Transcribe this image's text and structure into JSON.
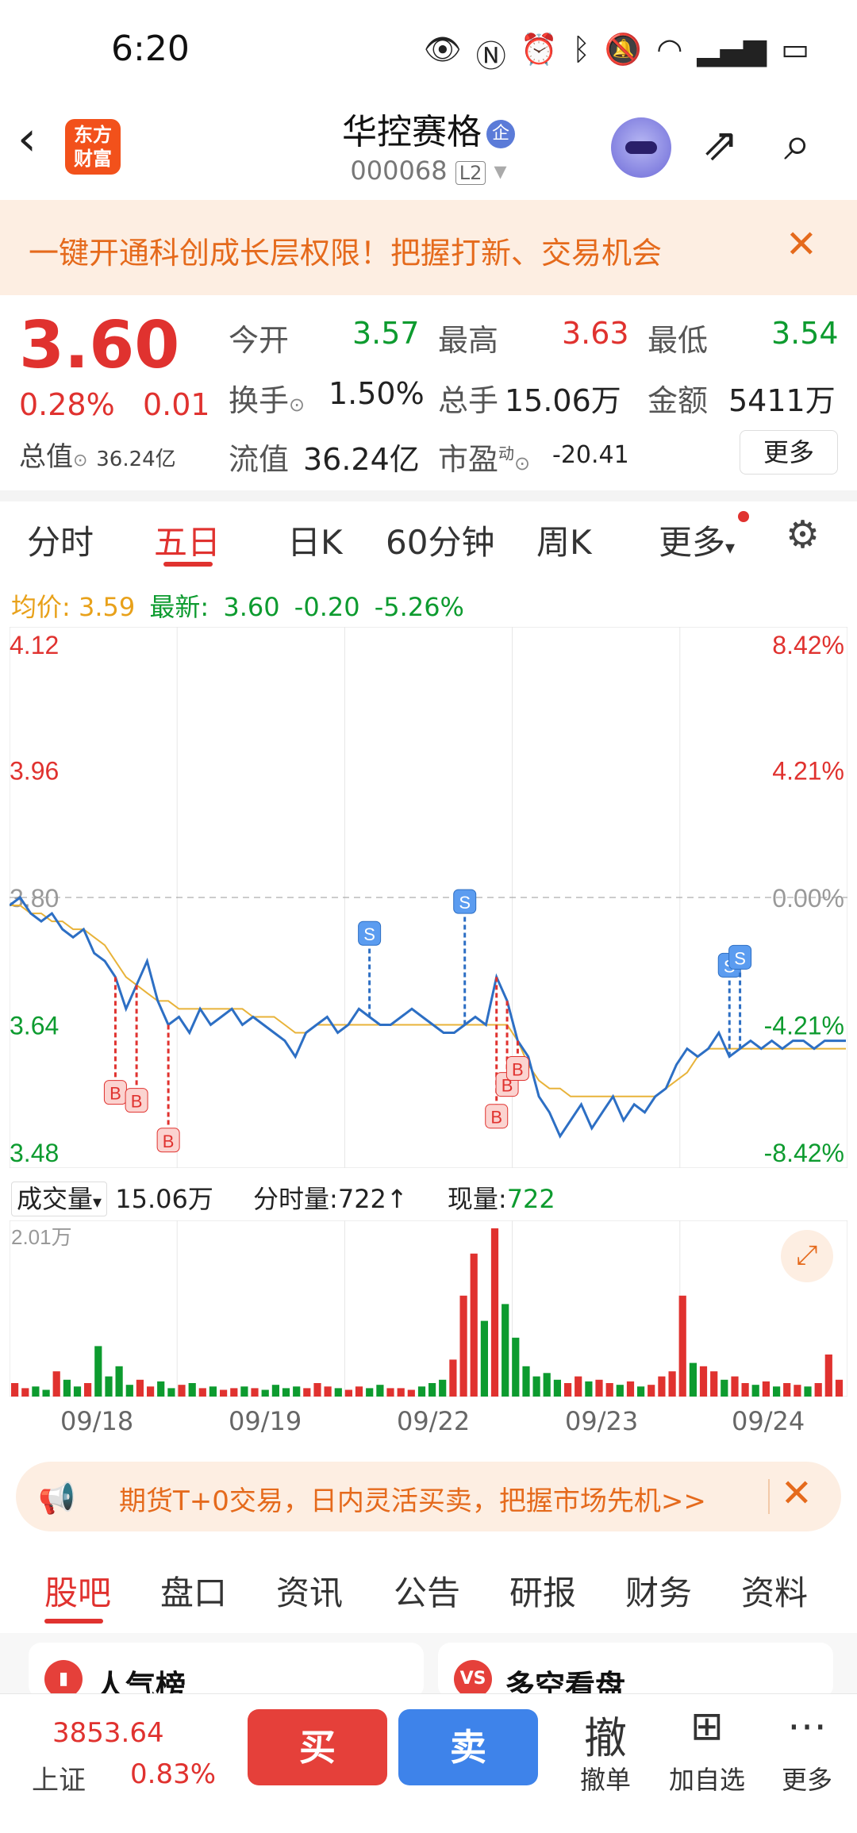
{
  "status": {
    "time": "6:20",
    "icons": [
      "eye-icon",
      "nfc-icon",
      "alarm-icon",
      "bluetooth-icon",
      "mute-icon",
      "wifi-icon",
      "4g-signal-icon",
      "battery-icon"
    ]
  },
  "header": {
    "logo_text": "东方\n财富",
    "stock_name": "华控赛格",
    "badge": "企",
    "stock_code": "000068",
    "level": "L2"
  },
  "banner_top": {
    "text": "一键开通科创成长层权限！把握打新、交易机会"
  },
  "quote": {
    "price": "3.60",
    "change_pct": "0.28%",
    "change": "0.01",
    "total_value_label": "总值",
    "total_value": "36.24亿",
    "open_label": "今开",
    "open": "3.57",
    "high_label": "最高",
    "high": "3.63",
    "low_label": "最低",
    "low": "3.54",
    "turnover_label": "换手",
    "turnover": "1.50%",
    "volume_label": "总手",
    "volume": "15.06万",
    "amount_label": "金额",
    "amount": "5411万",
    "float_label": "流值",
    "float_value": "36.24亿",
    "pe_label": "市盈",
    "pe_sup": "动",
    "pe": "-20.41",
    "more": "更多"
  },
  "tabs": [
    "分时",
    "五日",
    "日K",
    "60分钟",
    "周K",
    "更多"
  ],
  "active_tab": "五日",
  "legend": {
    "avg_label": "均价:",
    "avg": "3.59",
    "latest_label": "最新:",
    "latest": "3.60",
    "chg": "-0.20",
    "chg_pct": "-5.26%"
  },
  "chart_data": {
    "type": "line",
    "title": "",
    "y_labels_left": [
      "4.12",
      "3.96",
      "3.80",
      "3.64",
      "3.48"
    ],
    "y_labels_right": [
      "8.42%",
      "4.21%",
      "0.00%",
      "-4.21%",
      "-8.42%"
    ],
    "ylim": [
      3.48,
      4.12
    ],
    "prev_close": 3.8,
    "x_dates": [
      "09/18",
      "09/19",
      "09/22",
      "09/23",
      "09/24"
    ],
    "price_series": [
      3.79,
      3.8,
      3.78,
      3.77,
      3.78,
      3.76,
      3.75,
      3.76,
      3.73,
      3.72,
      3.7,
      3.66,
      3.69,
      3.72,
      3.67,
      3.64,
      3.65,
      3.63,
      3.66,
      3.64,
      3.65,
      3.66,
      3.64,
      3.65,
      3.64,
      3.63,
      3.62,
      3.6,
      3.63,
      3.64,
      3.65,
      3.63,
      3.64,
      3.66,
      3.65,
      3.64,
      3.64,
      3.65,
      3.66,
      3.65,
      3.64,
      3.63,
      3.63,
      3.64,
      3.65,
      3.64,
      3.7,
      3.67,
      3.62,
      3.6,
      3.55,
      3.53,
      3.5,
      3.52,
      3.54,
      3.51,
      3.53,
      3.55,
      3.52,
      3.54,
      3.53,
      3.55,
      3.56,
      3.59,
      3.61,
      3.6,
      3.61,
      3.63,
      3.6,
      3.61,
      3.62,
      3.61,
      3.62,
      3.61,
      3.62,
      3.62,
      3.61,
      3.62,
      3.62,
      3.62
    ],
    "avg_series": [
      3.79,
      3.79,
      3.78,
      3.78,
      3.77,
      3.77,
      3.76,
      3.76,
      3.75,
      3.74,
      3.72,
      3.7,
      3.69,
      3.68,
      3.67,
      3.67,
      3.66,
      3.66,
      3.66,
      3.66,
      3.66,
      3.66,
      3.66,
      3.65,
      3.65,
      3.65,
      3.64,
      3.63,
      3.63,
      3.64,
      3.64,
      3.64,
      3.64,
      3.64,
      3.64,
      3.64,
      3.64,
      3.64,
      3.64,
      3.64,
      3.64,
      3.64,
      3.64,
      3.64,
      3.64,
      3.64,
      3.64,
      3.64,
      3.62,
      3.59,
      3.57,
      3.56,
      3.56,
      3.55,
      3.55,
      3.55,
      3.55,
      3.55,
      3.55,
      3.55,
      3.55,
      3.55,
      3.56,
      3.57,
      3.58,
      3.6,
      3.61,
      3.61,
      3.61,
      3.61,
      3.61,
      3.61,
      3.61,
      3.61,
      3.61,
      3.61,
      3.61,
      3.61,
      3.61,
      3.61
    ],
    "buy_markers": [
      {
        "i": 10,
        "y": 3.61
      },
      {
        "i": 12,
        "y": 3.6
      },
      {
        "i": 15,
        "y": 3.55
      },
      {
        "i": 46,
        "y": 3.58
      },
      {
        "i": 47,
        "y": 3.62
      },
      {
        "i": 48,
        "y": 3.64
      }
    ],
    "sell_markers": [
      {
        "i": 34,
        "y": 3.73
      },
      {
        "i": 43,
        "y": 3.77
      },
      {
        "i": 68,
        "y": 3.69
      },
      {
        "i": 69,
        "y": 3.7
      }
    ],
    "volume_max_label": "2.01万",
    "volume_bars": [
      0.08,
      0.05,
      0.06,
      0.04,
      0.15,
      0.1,
      0.06,
      0.08,
      0.3,
      0.12,
      0.18,
      0.07,
      0.1,
      0.06,
      0.09,
      0.05,
      0.07,
      0.08,
      0.05,
      0.06,
      0.04,
      0.05,
      0.06,
      0.05,
      0.04,
      0.07,
      0.05,
      0.06,
      0.05,
      0.08,
      0.06,
      0.05,
      0.04,
      0.06,
      0.05,
      0.07,
      0.05,
      0.05,
      0.04,
      0.06,
      0.08,
      0.1,
      0.22,
      0.6,
      0.85,
      0.45,
      1.0,
      0.55,
      0.35,
      0.18,
      0.12,
      0.14,
      0.1,
      0.08,
      0.12,
      0.09,
      0.1,
      0.08,
      0.07,
      0.09,
      0.06,
      0.07,
      0.12,
      0.15,
      0.6,
      0.2,
      0.18,
      0.15,
      0.1,
      0.12,
      0.08,
      0.07,
      0.09,
      0.06,
      0.08,
      0.07,
      0.06,
      0.08,
      0.25,
      0.1
    ]
  },
  "volume_row": {
    "select": "成交量",
    "total": "15.06万",
    "tick_label": "分时量:",
    "tick": "722↑",
    "now_label": "现量:",
    "now": "722"
  },
  "banner_bottom": {
    "text": "期货T+0交易，日内灵活买卖，把握市场先机>>"
  },
  "sub_tabs": [
    "股吧",
    "盘口",
    "资讯",
    "公告",
    "研报",
    "财务",
    "资料"
  ],
  "cards": [
    {
      "label": "人气榜",
      "icon": "rank-icon"
    },
    {
      "label": "多空看盘",
      "icon": "vs-icon"
    }
  ],
  "bottom_bar": {
    "index_value": "3853.64",
    "index_name": "上证",
    "index_pct": "0.83%",
    "buy": "买",
    "sell": "卖",
    "cancel_icon": "撤",
    "cancel": "撤单",
    "watch": "加自选",
    "more": "更多"
  }
}
